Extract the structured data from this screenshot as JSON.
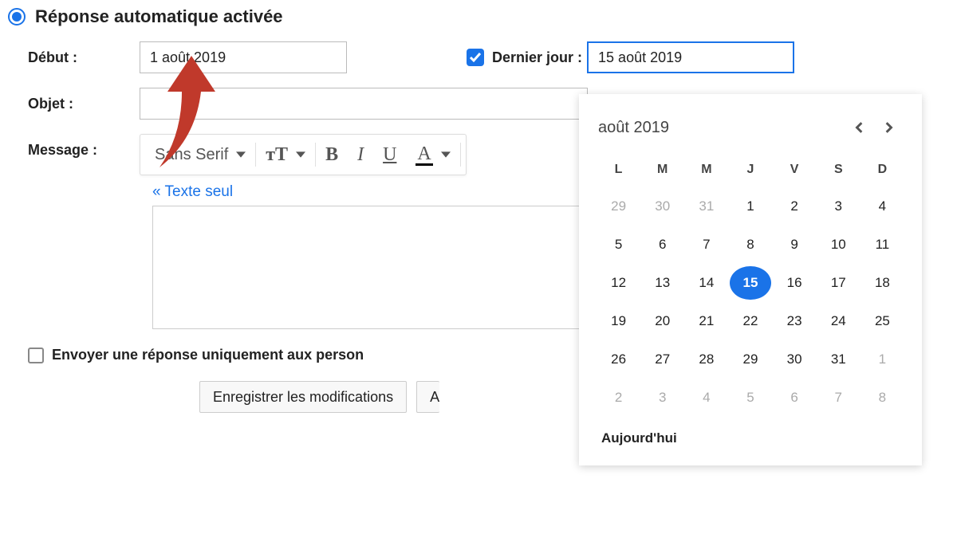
{
  "option": {
    "on_label": "Réponse automatique activée"
  },
  "fields": {
    "start_label": "Début :",
    "start_value": "1 août 2019",
    "end_label": "Dernier jour :",
    "end_value": "15 août 2019",
    "subject_label": "Objet :",
    "message_label": "Message :"
  },
  "toolbar": {
    "font": "Sans Serif",
    "plain_text": "« Texte seul"
  },
  "footer": {
    "contacts_only": "Envoyer une réponse uniquement aux person",
    "save": "Enregistrer les modifications",
    "cancel": "A"
  },
  "datepicker": {
    "month": "août 2019",
    "dow": [
      "L",
      "M",
      "M",
      "J",
      "V",
      "S",
      "D"
    ],
    "days": [
      {
        "n": 29,
        "muted": true
      },
      {
        "n": 30,
        "muted": true
      },
      {
        "n": 31,
        "muted": true
      },
      {
        "n": 1
      },
      {
        "n": 2
      },
      {
        "n": 3
      },
      {
        "n": 4
      },
      {
        "n": 5
      },
      {
        "n": 6
      },
      {
        "n": 7
      },
      {
        "n": 8
      },
      {
        "n": 9
      },
      {
        "n": 10
      },
      {
        "n": 11
      },
      {
        "n": 12
      },
      {
        "n": 13
      },
      {
        "n": 14
      },
      {
        "n": 15,
        "selected": true
      },
      {
        "n": 16
      },
      {
        "n": 17
      },
      {
        "n": 18
      },
      {
        "n": 19
      },
      {
        "n": 20
      },
      {
        "n": 21
      },
      {
        "n": 22
      },
      {
        "n": 23
      },
      {
        "n": 24
      },
      {
        "n": 25
      },
      {
        "n": 26
      },
      {
        "n": 27
      },
      {
        "n": 28
      },
      {
        "n": 29
      },
      {
        "n": 30
      },
      {
        "n": 31
      },
      {
        "n": 1,
        "muted": true
      },
      {
        "n": 2,
        "muted": true
      },
      {
        "n": 3,
        "muted": true
      },
      {
        "n": 4,
        "muted": true
      },
      {
        "n": 5,
        "muted": true
      },
      {
        "n": 6,
        "muted": true
      },
      {
        "n": 7,
        "muted": true
      },
      {
        "n": 8,
        "muted": true
      }
    ],
    "today": "Aujourd'hui"
  }
}
